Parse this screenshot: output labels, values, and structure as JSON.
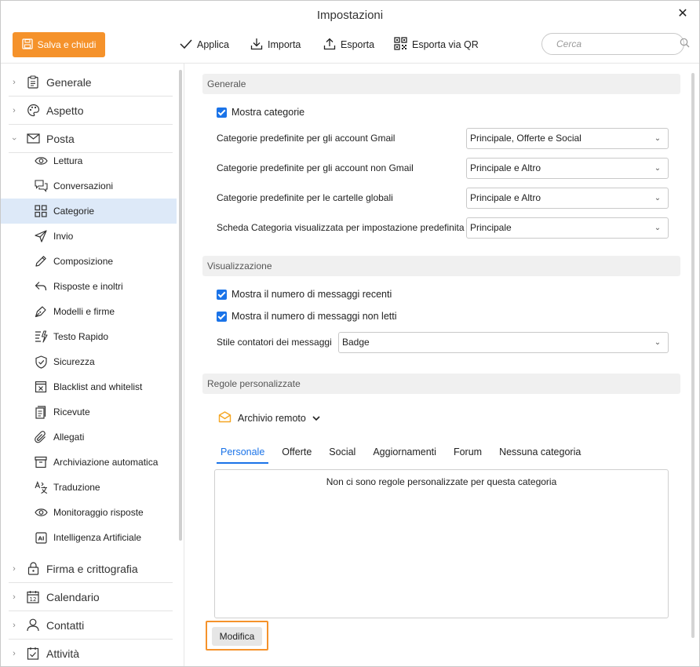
{
  "window": {
    "title": "Impostazioni",
    "close_label": "✕"
  },
  "toolbar": {
    "save_label": "Salva e chiudi",
    "apply_label": "Applica",
    "import_label": "Importa",
    "export_label": "Esporta",
    "export_qr_label": "Esporta via QR",
    "search_placeholder": "Cerca"
  },
  "sidebar": {
    "sections": {
      "generale": "Generale",
      "aspetto": "Aspetto",
      "posta": "Posta",
      "firma": "Firma e crittografia",
      "calendario": "Calendario",
      "contatti": "Contatti",
      "attivita": "Attività"
    },
    "items": [
      "Lettura",
      "Conversazioni",
      "Categorie",
      "Invio",
      "Composizione",
      "Risposte e inoltri",
      "Modelli e firme",
      "Testo Rapido",
      "Sicurezza",
      "Blacklist and whitelist",
      "Ricevute",
      "Allegati",
      "Archiviazione automatica",
      "Traduzione",
      "Monitoraggio risposte",
      "Intelligenza Artificiale"
    ],
    "active_item": "Categorie"
  },
  "general": {
    "header": "Generale",
    "show_categories": {
      "label": "Mostra categorie",
      "checked": true
    },
    "gmail": {
      "label": "Categorie predefinite per gli account Gmail",
      "value": "Principale, Offerte e Social"
    },
    "non_gmail": {
      "label": "Categorie predefinite per gli account non Gmail",
      "value": "Principale e Altro"
    },
    "global": {
      "label": "Categorie predefinite per le cartelle globali",
      "value": "Principale e Altro"
    },
    "default_tab": {
      "label": "Scheda Categoria visualizzata per impostazione predefinita",
      "value": "Principale"
    }
  },
  "display": {
    "header": "Visualizzazione",
    "recent": {
      "label": "Mostra il numero di messaggi recenti",
      "checked": true
    },
    "unread": {
      "label": "Mostra il numero di messaggi non letti",
      "checked": true
    },
    "counter_style": {
      "label": "Stile contatori dei messaggi",
      "value": "Badge"
    }
  },
  "rules": {
    "header": "Regole personalizzate",
    "account": "Archivio remoto",
    "tabs": [
      "Personale",
      "Offerte",
      "Social",
      "Aggiornamenti",
      "Forum",
      "Nessuna categoria"
    ],
    "active_tab": "Personale",
    "empty_message": "Non ci sono regole personalizzate per questa categoria",
    "edit_label": "Modifica"
  },
  "colors": {
    "accent": "#f5922b",
    "blue": "#1a73e8",
    "active_bg": "#dde9f8"
  }
}
